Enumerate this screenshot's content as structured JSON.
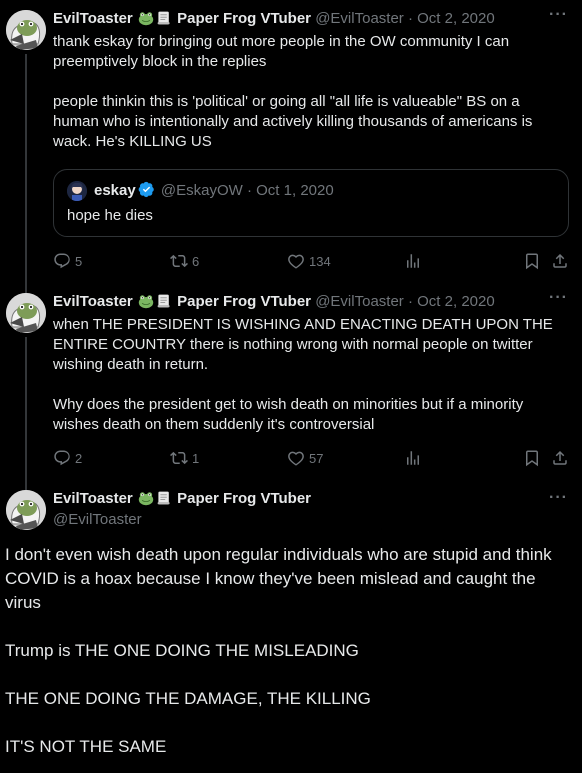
{
  "tweets": [
    {
      "display_name": "EvilToaster",
      "suffix": "Paper Frog VTuber",
      "handle": "@EvilToaster",
      "separator": "·",
      "date": "Oct 2, 2020",
      "text": "thank eskay for bringing out more people in the OW community I can preemptively block in the replies\n\npeople thinkin this is 'political' or going all \"all life is valueable\" BS on a human who is intentionally and actively killing thousands of americans is wack. He's KILLING US",
      "quote": {
        "display_name": "eskay",
        "handle": "@EskayOW",
        "separator": "·",
        "date": "Oct 1, 2020",
        "text": "hope he dies"
      },
      "replies": "5",
      "retweets": "6",
      "likes": "134"
    },
    {
      "display_name": "EvilToaster",
      "suffix": "Paper Frog VTuber",
      "handle": "@EvilToaster",
      "separator": "·",
      "date": "Oct 2, 2020",
      "text": "when THE PRESIDENT IS WISHING AND ENACTING DEATH UPON THE ENTIRE COUNTRY there is nothing wrong with normal people on twitter wishing death in return.\n\nWhy does the president get to wish death on minorities but if a minority wishes death on them suddenly it's controversial",
      "replies": "2",
      "retweets": "1",
      "likes": "57"
    },
    {
      "display_name": "EvilToaster",
      "suffix": "Paper Frog VTuber",
      "handle": "@EvilToaster",
      "text": "I don't even wish death upon regular individuals who are stupid and think COVID is a hoax because I know they've been mislead and caught the virus\n\nTrump is THE ONE DOING THE MISLEADING\n\nTHE ONE DOING THE DAMAGE, THE KILLING\n\nIT'S NOT THE SAME"
    }
  ],
  "icons": {
    "more": "more-icon",
    "reply": "reply-icon",
    "retweet": "retweet-icon",
    "like": "like-icon",
    "views": "views-icon",
    "bookmark": "bookmark-icon",
    "share": "share-icon",
    "frog": "frog-emoji",
    "scroll": "scroll-emoji",
    "verified": "verified-badge-icon"
  },
  "colors": {
    "background": "#000000",
    "text": "#e7e9ea",
    "secondary": "#71767b",
    "border": "#2f3336",
    "verified": "#1d9bf0"
  }
}
